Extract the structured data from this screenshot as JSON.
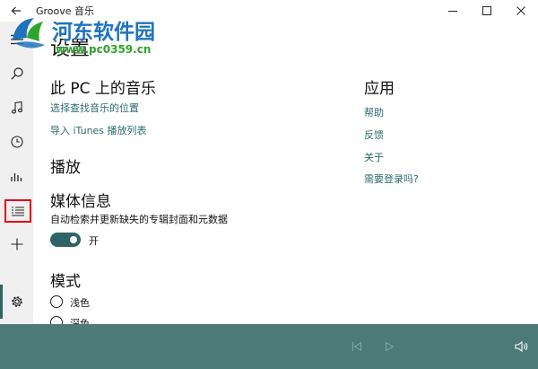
{
  "window": {
    "title": "Groove 音乐",
    "back_icon": "back-arrow-icon",
    "controls": [
      "minimize-icon",
      "maximize-icon",
      "close-icon"
    ]
  },
  "sidebar": {
    "items": [
      {
        "icon": "hamburger-menu-icon"
      },
      {
        "icon": "search-icon"
      },
      {
        "icon": "music-note-icon"
      },
      {
        "icon": "recent-clock-icon"
      },
      {
        "icon": "charts-icon"
      },
      {
        "icon": "now-playing-list-icon",
        "selected": true
      },
      {
        "icon": "add-icon"
      },
      {
        "icon": "settings-gear-icon",
        "active": true
      }
    ],
    "highlight_color": "#e30613"
  },
  "settings": {
    "page_title": "设置",
    "music_on_pc": {
      "heading": "此 PC 上的音乐",
      "choose_location_link": "选择查找音乐的位置",
      "import_itunes_link": "导入 iTunes 播放列表"
    },
    "playback": {
      "heading": "播放"
    },
    "media_info": {
      "heading": "媒体信息",
      "description": "自动检索并更新缺失的专辑封面和元数据",
      "toggle_state": "on",
      "toggle_label": "开"
    },
    "mode": {
      "heading": "模式",
      "options": [
        "浅色",
        "深色"
      ]
    },
    "app": {
      "heading": "应用",
      "links": [
        "帮助",
        "反馈",
        "关于",
        "需要登录吗?"
      ]
    }
  },
  "player_bar": {
    "controls": [
      "previous-icon",
      "play-icon",
      "volume-icon"
    ],
    "background": "#4b7a79"
  },
  "watermark": {
    "title": "河东软件园",
    "url": "www.pc0359.cn"
  },
  "colors": {
    "accent": "#2f6466",
    "link": "#2b6b6e"
  }
}
